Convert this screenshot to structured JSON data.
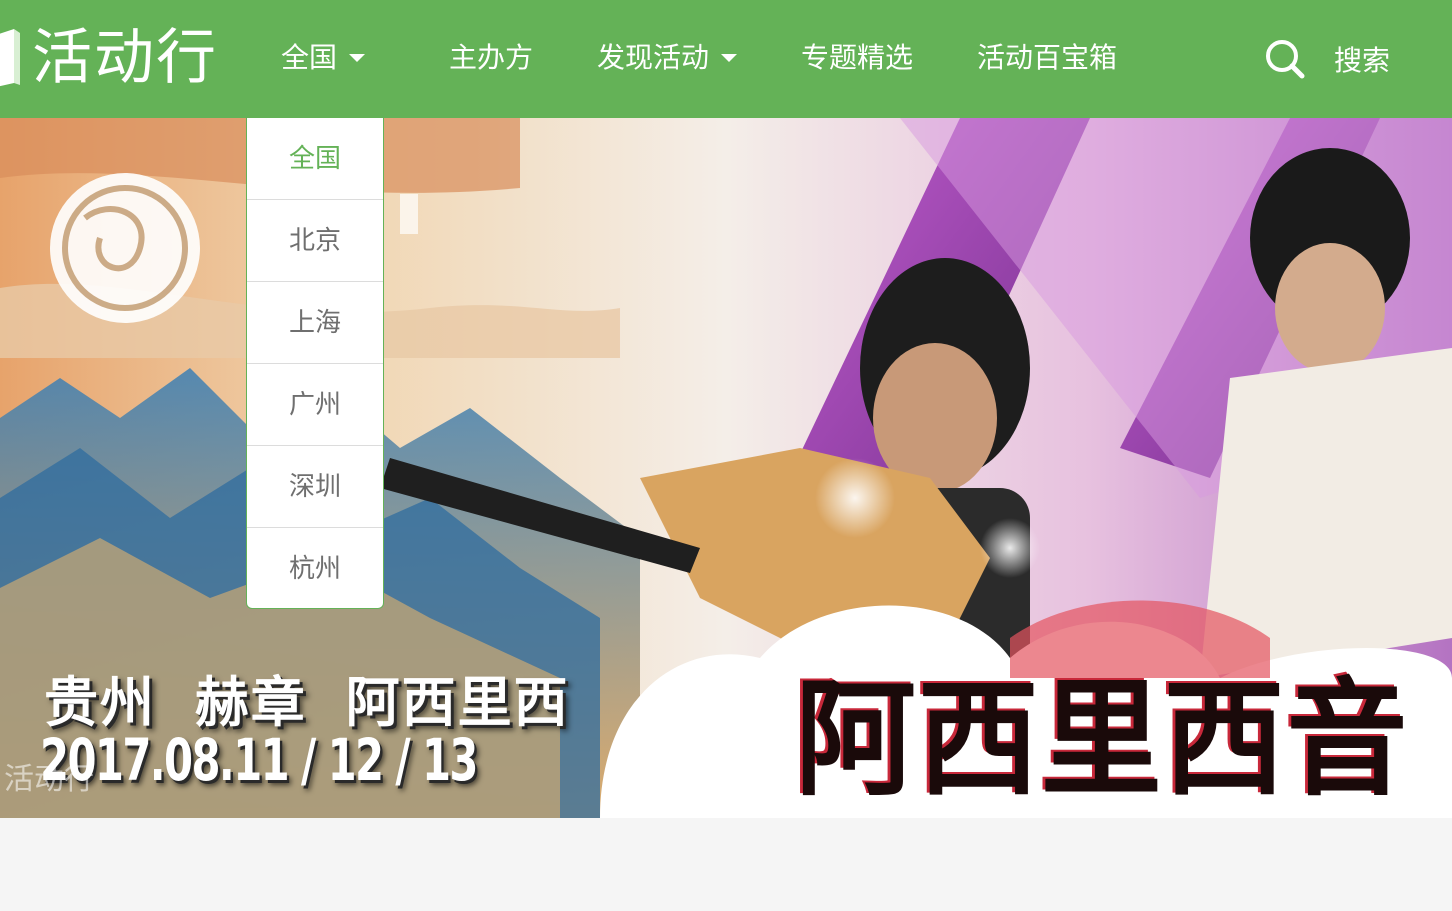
{
  "brand": {
    "name": "活动行",
    "accent_color": "#64b257"
  },
  "nav": {
    "items": [
      {
        "label": "全国",
        "has_caret": true
      },
      {
        "label": "主办方",
        "has_caret": false
      },
      {
        "label": "发现活动",
        "has_caret": true
      },
      {
        "label": "专题精选",
        "has_caret": false
      },
      {
        "label": "活动百宝箱",
        "has_caret": false
      }
    ],
    "search_label": "搜索",
    "search_icon": "search-icon"
  },
  "city_dropdown": {
    "selected": "全国",
    "options": [
      "全国",
      "北京",
      "上海",
      "广州",
      "深圳",
      "杭州"
    ]
  },
  "banner": {
    "location_line": "贵州 赫章 阿西里西",
    "date_line": "2017.08.11 / 12 / 13",
    "title": "阿西里西音",
    "watermark": "活动行"
  }
}
